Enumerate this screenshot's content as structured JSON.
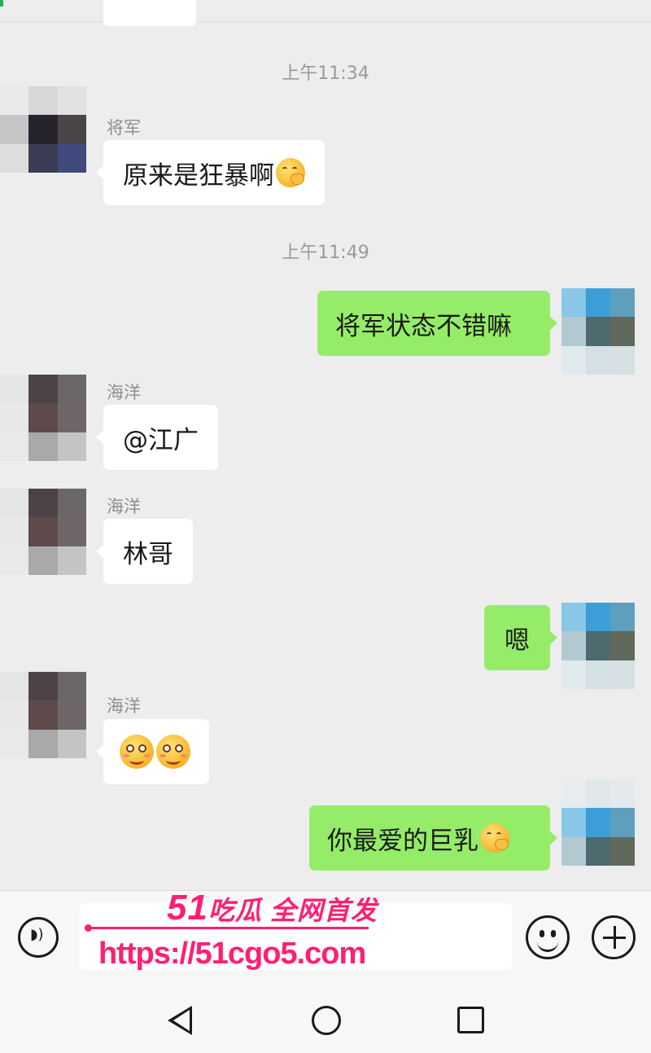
{
  "messages": [
    {
      "type": "timestamp",
      "text": "上午11:34"
    },
    {
      "type": "incoming",
      "sender": "将军",
      "text": "原来是狂暴啊",
      "emoji": "hand-over-mouth-emoji"
    },
    {
      "type": "timestamp",
      "text": "上午11:49"
    },
    {
      "type": "outgoing",
      "text": "将军状态不错嘛"
    },
    {
      "type": "incoming",
      "sender": "海洋",
      "text": "@江广"
    },
    {
      "type": "incoming",
      "sender": "海洋",
      "text": "林哥"
    },
    {
      "type": "outgoing",
      "text": "嗯"
    },
    {
      "type": "incoming",
      "sender": "海洋",
      "text": "",
      "emoji": "shy-smile-emoji x2"
    },
    {
      "type": "outgoing",
      "text": "你最爱的巨乳",
      "emoji": "hand-over-mouth-emoji"
    }
  ],
  "input_bar": {
    "voice_icon": "voice-icon",
    "emoji_icon": "smiley-icon",
    "more_icon": "plus-icon"
  },
  "watermark": {
    "line1_num": "51",
    "line1_text": "吃瓜 全网首发",
    "line2": "https://51cgo5.com"
  },
  "navbar": {
    "icons": [
      "back-icon",
      "home-icon",
      "recent-apps-icon"
    ]
  },
  "colors": {
    "bg": "#ededed",
    "outgoing": "#95ec69",
    "incoming": "#ffffff",
    "watermark": "#ff1f72"
  }
}
